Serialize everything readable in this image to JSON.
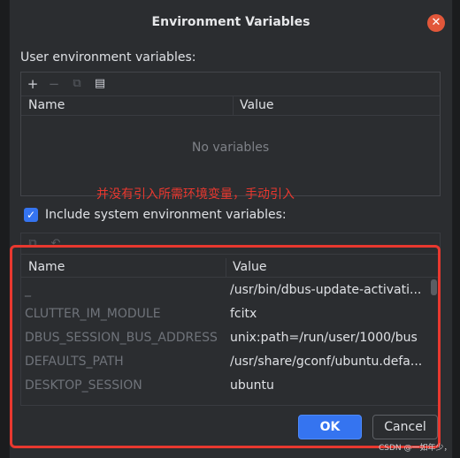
{
  "window": {
    "title": "Environment Variables",
    "close_icon": "close-icon"
  },
  "user_section": {
    "label": "User environment variables:",
    "toolbar": [
      {
        "name": "add-icon",
        "glyph": "+",
        "enabled": true
      },
      {
        "name": "remove-icon",
        "glyph": "−",
        "enabled": false
      },
      {
        "name": "copy-icon",
        "glyph": "⧉",
        "enabled": false
      },
      {
        "name": "paste-icon",
        "glyph": "📋",
        "enabled": true
      }
    ],
    "columns": {
      "name": "Name",
      "value": "Value"
    },
    "empty_text": "No variables"
  },
  "annotation": "并没有引入所需环境变量，手动引入",
  "system_section": {
    "checkbox_label": "Include system environment variables:",
    "checked": true,
    "toolbar": [
      {
        "name": "copy-icon",
        "glyph": "⧉",
        "enabled": false
      },
      {
        "name": "undo-icon",
        "glyph": "↶",
        "enabled": false
      }
    ],
    "columns": {
      "name": "Name",
      "value": "Value"
    },
    "rows": [
      {
        "name": "_",
        "value": "/usr/bin/dbus-update-activati..."
      },
      {
        "name": "CLUTTER_IM_MODULE",
        "value": "fcitx"
      },
      {
        "name": "DBUS_SESSION_BUS_ADDRESS",
        "value": "unix:path=/run/user/1000/bus"
      },
      {
        "name": "DEFAULTS_PATH",
        "value": "/usr/share/gconf/ubuntu.defa..."
      },
      {
        "name": "DESKTOP_SESSION",
        "value": "ubuntu"
      }
    ]
  },
  "buttons": {
    "ok": "OK",
    "cancel": "Cancel"
  },
  "watermark": "CSDN @一如年少，",
  "colors": {
    "accent": "#3574f0",
    "annotation": "#e8382f",
    "close": "#e2573a"
  }
}
